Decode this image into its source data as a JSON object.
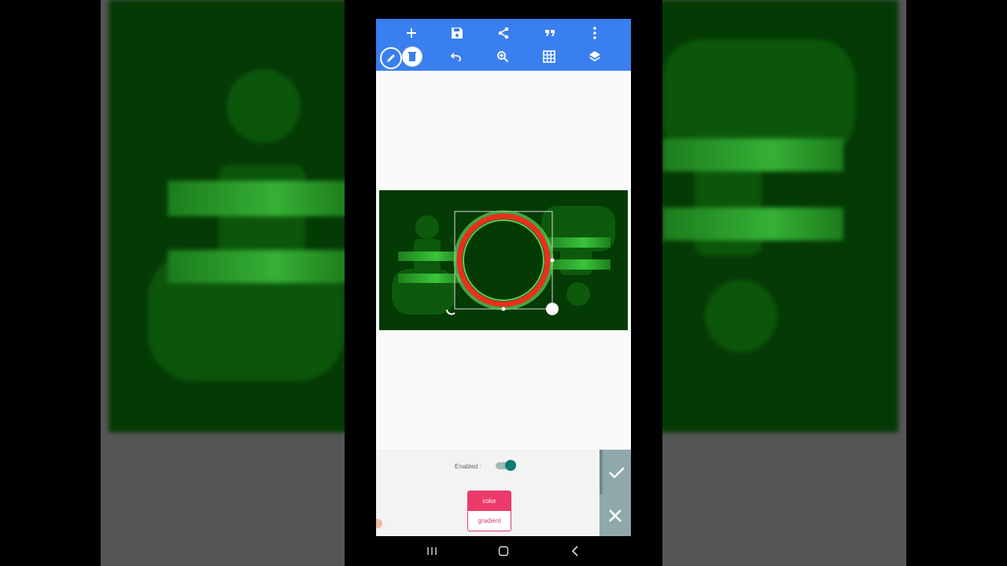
{
  "toolbar": {
    "top_row": [
      {
        "name": "add-icon"
      },
      {
        "name": "save-icon"
      },
      {
        "name": "share-icon"
      },
      {
        "name": "quote-icon"
      },
      {
        "name": "more-vert-icon"
      }
    ],
    "bottom_row": [
      {
        "name": "pencil-icon"
      },
      {
        "name": "delete-icon"
      },
      {
        "name": "undo-icon"
      },
      {
        "name": "zoom-in-icon"
      },
      {
        "name": "grid-icon"
      },
      {
        "name": "layers-icon"
      }
    ],
    "color": "#3a7ff0"
  },
  "canvas": {
    "background": "#043a04",
    "ring_color": "#e8301d",
    "ring_glow": "#5fd35f"
  },
  "panel": {
    "enabled_label": "Enabled :",
    "enabled": true,
    "options": [
      "color",
      "gradient"
    ],
    "selected_option": "color",
    "accent": "#ec3a6b",
    "confirm_icon": "check-icon",
    "cancel_icon": "close-icon"
  },
  "navbar": {
    "buttons": [
      "recents-icon",
      "home-icon",
      "back-icon"
    ]
  }
}
